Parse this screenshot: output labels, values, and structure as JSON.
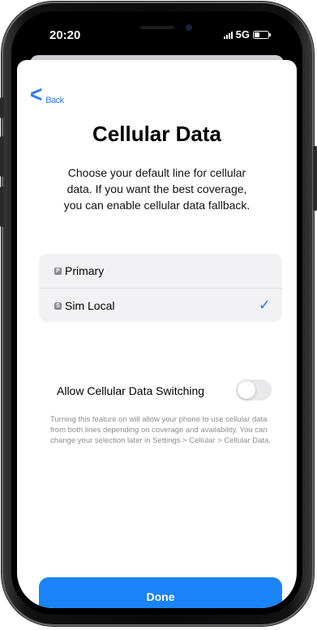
{
  "status_bar": {
    "time": "20:20",
    "network": "5G"
  },
  "navigation": {
    "back_label": "Back"
  },
  "page": {
    "title": "Cellular Data",
    "subtitle": "Choose your default line for cellular data. If you want the best coverage, you can enable cellular data fallback."
  },
  "lines": [
    {
      "badge": "P",
      "label": "Primary",
      "selected": false
    },
    {
      "badge": "S",
      "label": "Sim Local",
      "selected": true
    }
  ],
  "data_switching": {
    "label": "Allow Cellular Data Switching",
    "enabled": false,
    "footnote": "Turning this feature on will allow your phone to use cellular data from both lines depending on coverage and availability. You can change your selection later in Settings > Cellular > Cellular Data."
  },
  "done_button": {
    "label": "Done"
  },
  "colors": {
    "accent": "#1a84f8",
    "link": "#2f7cf6",
    "group_background": "#f2f2f4",
    "footnote": "#8e8e93"
  },
  "icons": {
    "back": "chevron-left-icon",
    "selected": "checkmark-icon",
    "sim": "sim-badge-icon"
  }
}
